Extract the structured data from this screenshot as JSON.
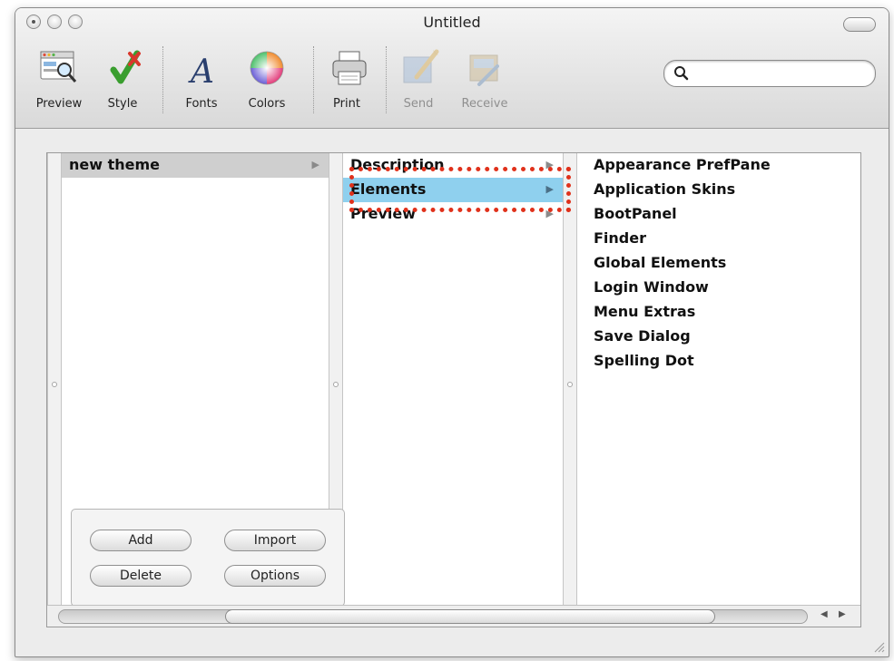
{
  "window": {
    "title": "Untitled"
  },
  "toolbar": {
    "preview": "Preview",
    "style": "Style",
    "fonts": "Fonts",
    "colors": "Colors",
    "print": "Print",
    "send": "Send",
    "receive": "Receive",
    "search_placeholder": ""
  },
  "columns": {
    "themes": [
      {
        "label": "new theme"
      }
    ],
    "sections": [
      {
        "label": "Description"
      },
      {
        "label": "Elements"
      },
      {
        "label": "Preview"
      }
    ],
    "elements": [
      {
        "label": "Appearance PrefPane"
      },
      {
        "label": "Application Skins"
      },
      {
        "label": "BootPanel"
      },
      {
        "label": "Finder"
      },
      {
        "label": "Global Elements"
      },
      {
        "label": "Login Window"
      },
      {
        "label": "Menu Extras"
      },
      {
        "label": "Save Dialog"
      },
      {
        "label": "Spelling Dot"
      }
    ]
  },
  "buttons": {
    "add": "Add",
    "import": "Import",
    "delete": "Delete",
    "options": "Options"
  },
  "colors": {
    "selection_blue": "#8fd0ee",
    "selection_grey": "#cfcfcf",
    "highlight_red": "#e0311b"
  }
}
